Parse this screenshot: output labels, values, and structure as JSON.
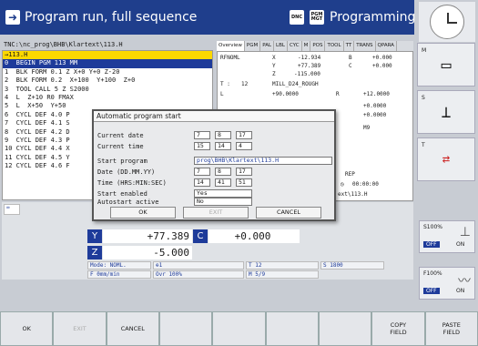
{
  "header": {
    "mode_title": "Program run, full sequence",
    "prog_mode": "Programming",
    "dnc": "DNC",
    "pgm_mgt": "PGM MGT"
  },
  "path": "TNC:\\nc_prog\\BHB\\Klartext\\113.H",
  "program_lines": [
    "→113.H",
    "0  BEGIN PGM 113 MM",
    "1  BLK FORM 0.1 Z X+0 Y+0 Z-20",
    "2  BLK FORM 0.2  X+100  Y+100  Z+0",
    "3  TOOL CALL 5 Z S2000",
    "4  L  Z+10 R0 FMAX",
    "5  L  X+50  Y+50",
    "6  CYCL DEF 4.0 P",
    "7  CYCL DEF 4.1 S",
    "8  CYCL DEF 4.2 D",
    "9  CYCL DEF 4.3 P",
    "10 CYCL DEF 4.4 X",
    "11 CYCL DEF 4.5 Y",
    "12 CYCL DEF 4.6 F"
  ],
  "status": {
    "tabs": [
      "Overview",
      "PGM",
      "PAL",
      "LBL",
      "CYC",
      "M",
      "POS",
      "TOOL",
      "TT",
      "TRANS",
      "QPARA"
    ],
    "rfnoml": "RFNOML",
    "x": "X",
    "x_val": "-12.934",
    "b": "B",
    "b_val": "+0.000",
    "y": "Y",
    "y_val": "+77.389",
    "c": "C",
    "c_val": "+0.000",
    "z": "Z",
    "z_val": "-115.000",
    "t_label": "T :",
    "t_num": "12",
    "t_name": "MILL_D24_ROUGH",
    "l_label": "L",
    "l_val": "+90.0000",
    "r_label": "R",
    "r_val": "+12.0000",
    "dl_val": "+0.0000",
    "dr_val": "+0.0000",
    "m9": "M9",
    "rep": "REP",
    "time": "00:00:00",
    "pgm_ref": "ext\\113.H"
  },
  "dialog": {
    "title": "Automatic program start",
    "current_date_label": "Current date",
    "cd": [
      "7",
      "8",
      "17"
    ],
    "current_time_label": "Current time",
    "ct": [
      "15",
      "14",
      "4"
    ],
    "start_program_label": "Start program",
    "start_program": "prog\\BHB\\Klartext\\113.H",
    "date_label": "Date (DD.MM.YY)",
    "d": [
      "7",
      "8",
      "17"
    ],
    "time_label": "Time (HRS:MIN:SEC)",
    "t": [
      "14",
      "41",
      "51"
    ],
    "start_enabled_label": "Start enabled",
    "start_enabled": "Yes",
    "autostart_label": "Autostart active",
    "autostart": "No",
    "ok": "OK",
    "exit": "EXIT",
    "cancel": "CANCEL"
  },
  "positions": {
    "y_axis": "Y",
    "y_val": "+77.389",
    "c_axis": "C",
    "c_val": "+0.000",
    "z_axis": "Z",
    "z_val": "-5.000",
    "mode": "Mode: NOML.",
    "feed": "F 0mm/min",
    "ovr": "Ovr 100%",
    "t12": "T 12",
    "m59": "M 5/9",
    "s1800": "S 1800"
  },
  "right_softkeys": [
    "M",
    "S",
    "T"
  ],
  "gauges": [
    {
      "label": "S100%",
      "off": "OFF",
      "on": "ON"
    },
    {
      "label": "F100%",
      "off": "OFF",
      "on": "ON"
    }
  ],
  "bottom_softkeys": [
    "OK",
    "EXIT",
    "CANCEL",
    "",
    "",
    "",
    "",
    "COPY\nFIELD",
    "PASTE\nFIELD"
  ]
}
